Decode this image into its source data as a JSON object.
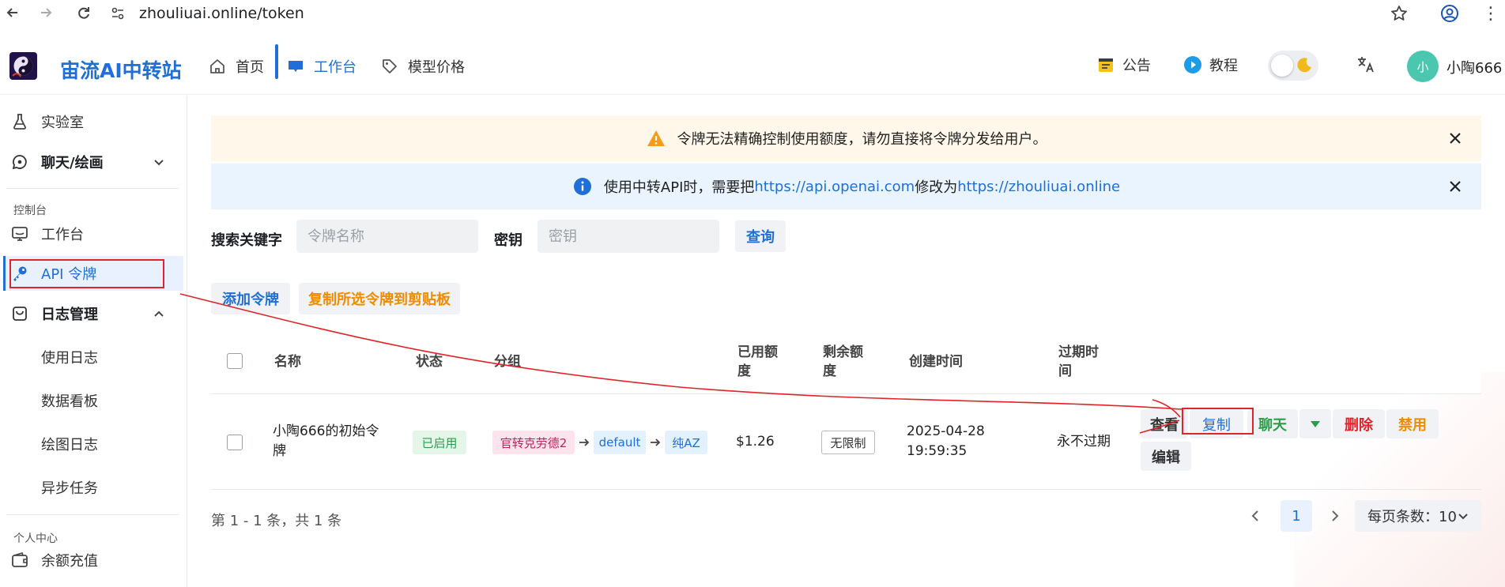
{
  "browser": {
    "url": "zhouliuai.online/token"
  },
  "header": {
    "brand": "宙流AI中转站",
    "nav": [
      {
        "label": "首页"
      },
      {
        "label": "工作台"
      },
      {
        "label": "模型价格"
      }
    ],
    "announcement": "公告",
    "tutorial": "教程",
    "avatar_initial": "小",
    "username": "小陶666"
  },
  "sidebar": {
    "items_top": [
      {
        "label": "实验室"
      },
      {
        "label": "聊天/绘画"
      }
    ],
    "section_console": "控制台",
    "console_items": [
      {
        "label": "工作台"
      },
      {
        "label": "API 令牌"
      },
      {
        "label": "日志管理"
      },
      {
        "label": "使用日志"
      },
      {
        "label": "数据看板"
      },
      {
        "label": "绘图日志"
      },
      {
        "label": "异步任务"
      }
    ],
    "section_personal": "个人中心",
    "personal_items": [
      {
        "label": "余额充值"
      }
    ]
  },
  "banners": {
    "warning": "令牌无法精确控制使用额度，请勿直接将令牌分发给用户。",
    "info_prefix": "使用中转API时，需要把",
    "info_link1": "https://api.openai.com",
    "info_mid": "修改为",
    "info_link2": "https://zhouliuai.online"
  },
  "search": {
    "keyword_label": "搜索关键字",
    "keyword_placeholder": "令牌名称",
    "key_label": "密钥",
    "key_placeholder": "密钥",
    "query_button": "查询"
  },
  "actions": {
    "add_token": "添加令牌",
    "copy_selected": "复制所选令牌到剪贴板"
  },
  "table": {
    "headers": {
      "name": "名称",
      "status": "状态",
      "group": "分组",
      "used_l1": "已用额",
      "used_l2": "度",
      "remain_l1": "剩余额",
      "remain_l2": "度",
      "created": "创建时间",
      "expire_l1": "过期时",
      "expire_l2": "间"
    },
    "rows": [
      {
        "name_l1": "小陶666的初始令",
        "name_l2": "牌",
        "status": "已启用",
        "group1": "官转克劳德2",
        "group2": "default",
        "group3": "纯AZ",
        "used": "$1.26",
        "remain": "无限制",
        "created_date": "2025-04-28",
        "created_time": "19:59:35",
        "expire": "永不过期",
        "btn_view": "查看",
        "btn_copy": "复制",
        "btn_chat": "聊天",
        "btn_delete": "删除",
        "btn_disable": "禁用",
        "btn_edit": "编辑"
      }
    ]
  },
  "pagination": {
    "summary": "第 1 - 1 条，共 1 条",
    "current_page": "1",
    "per_page": "每页条数：10"
  },
  "colors": {
    "primary": "#1f6fd6",
    "annotation_red": "#e0242a"
  }
}
